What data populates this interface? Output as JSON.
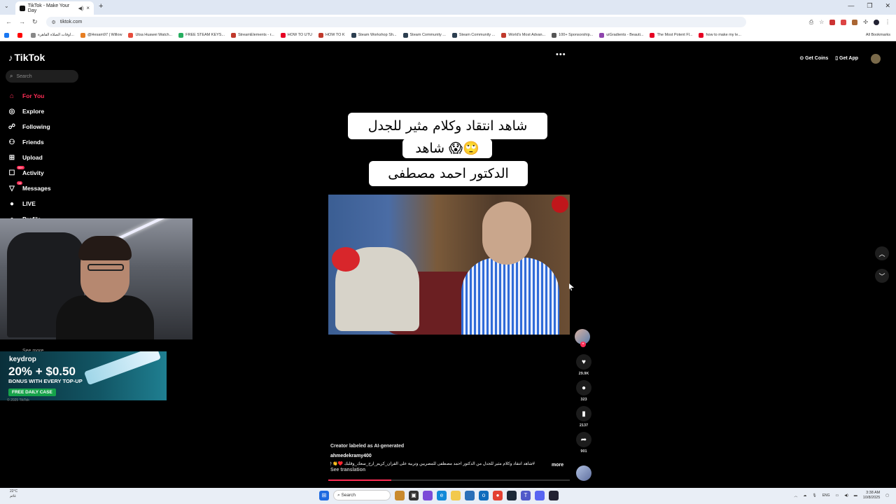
{
  "browser": {
    "tab_title": "TikTok - Make Your Day",
    "url": "tiktok.com",
    "bookmarks": [
      "",
      "",
      "اوقات الصلاة القاهرة...",
      "@Hesam97 | Willow",
      "Utsa Huawei Watch...",
      "FREE STEAM KEYS...",
      "StreamElements - r...",
      "HOW TO UTU",
      "HOW TO K",
      "Steam Workshop Sh...",
      "Steam Community ...",
      "Steam Community ...",
      "World's Most Advan...",
      "100+ Sponsorship...",
      "uiGradients - Beauti...",
      "The Most Potent Fl...",
      "how to make my le..."
    ],
    "all_bookmarks": "All Bookmarks"
  },
  "tiktok": {
    "logo": "TikTok",
    "search_placeholder": "Search",
    "sidebar": [
      {
        "label": "For You",
        "icon": "home-icon",
        "glyph": "⌂",
        "active": true
      },
      {
        "label": "Explore",
        "icon": "compass-icon",
        "glyph": "◎",
        "active": false
      },
      {
        "label": "Following",
        "icon": "following-icon",
        "glyph": "☍",
        "active": false
      },
      {
        "label": "Friends",
        "icon": "friends-icon",
        "glyph": "⚇",
        "active": false
      },
      {
        "label": "Upload",
        "icon": "upload-icon",
        "glyph": "⊞",
        "active": false
      },
      {
        "label": "Activity",
        "icon": "activity-icon",
        "glyph": "☐",
        "active": false,
        "badge": "99+"
      },
      {
        "label": "Messages",
        "icon": "messages-icon",
        "glyph": "▽",
        "active": false,
        "badge": "14"
      },
      {
        "label": "LIVE",
        "icon": "live-icon",
        "glyph": "●",
        "active": false
      },
      {
        "label": "Profile",
        "icon": "profile-icon",
        "glyph": "●",
        "active": false
      }
    ],
    "get_coins": "Get Coins",
    "get_app": "Get App",
    "see_more": "See more",
    "copyright": "© 2025 TikTok",
    "caption_line1": "شاهد انتقاد وكلام مثير للجدل",
    "caption_line2": "شاهد 😱🙄",
    "caption_line3": "الدكتور احمد مصطفى",
    "ai_label": "Creator labeled as AI-generated",
    "author": "ahmedekramy400",
    "description": "#شاهد انتقاد وكلام مثير للجدل من الدكتور احمد مصطفى للمصريين وتربية على القرآن_كريم_ارح_سعك_وقلبك ♥️👏 IQ 🤯🥹 ...",
    "more": "more",
    "see_translation": "See translation",
    "likes": "29.9K",
    "comments": "323",
    "saves": "2137",
    "shares": "901",
    "progress": 0.26
  },
  "promo": {
    "brand": "keydrop",
    "headline": "20% + $0.50",
    "subline": "BONUS WITH EVERY TOP-UP",
    "button": "FREE DAILY CASE"
  },
  "taskbar": {
    "temp": "22°C",
    "weather_text": "غائم",
    "search": "Search",
    "lang": "ENG",
    "time": "3:38 AM",
    "date": "10/8/2025"
  }
}
